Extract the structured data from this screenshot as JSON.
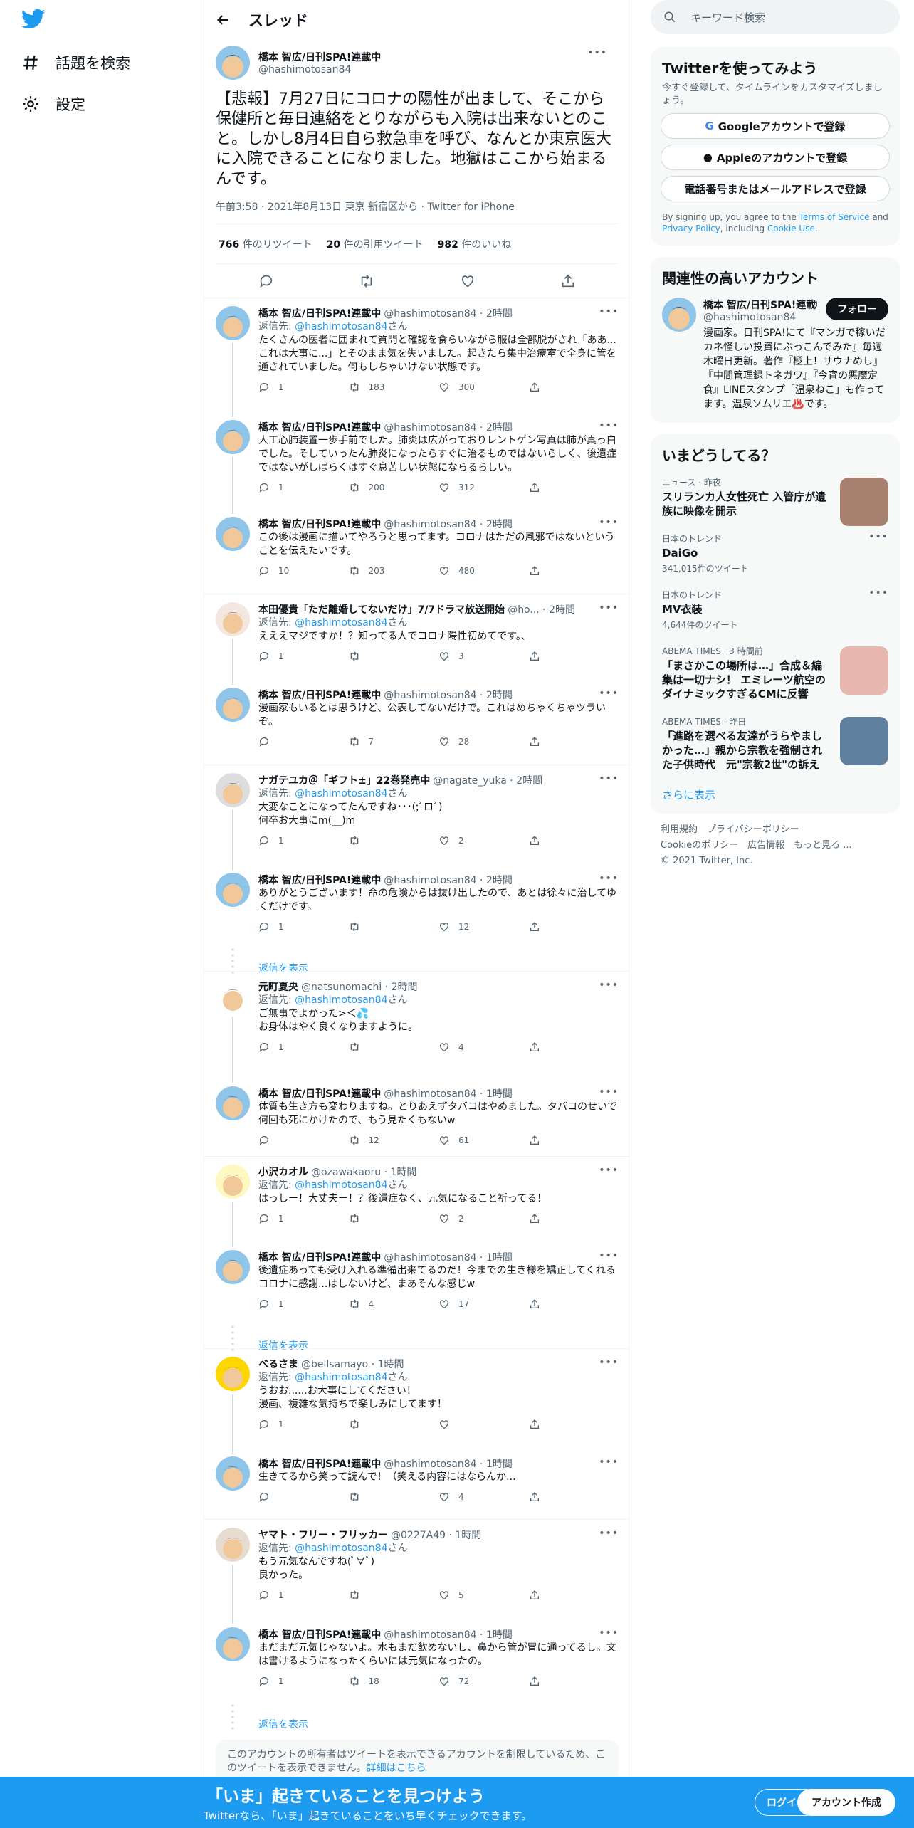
{
  "nav": {
    "explore": "話題を検索",
    "settings": "設定"
  },
  "header": {
    "title": "スレッド"
  },
  "focal": {
    "name": "橋本 智広/日刊SPA!連載中",
    "handle": "@hashimotosan84",
    "text": "【悲報】7月27日にコロナの陽性が出まして、そこから保健所と毎日連絡をとりながらも入院は出来ないとのこと。しかし8月4日自ら救急車を呼び、なんとか東京医大に入院できることになりました。地獄はここから始まるんです。",
    "meta": "午前3:58 · 2021年8月13日 東京 新宿区から · Twitter for iPhone",
    "rt_count": "766",
    "rt_label": "件のリツイート",
    "quote_count": "20",
    "quote_label": "件の引用ツイート",
    "like_count": "982",
    "like_label": "件のいいね"
  },
  "replies": [
    {
      "name": "橋本 智広/日刊SPA!連載中",
      "handle": "@hashimotosan84 · 2時間",
      "reply_to": "@hashimotosan84",
      "text": "たくさんの医者に囲まれて質問と確認を食らいながら服は全部脱がされ「ああ...これは大事に...」とそのまま気を失いました。起きたら集中治療室で全身に管を通されていました。何もしちゃいけない状態です。",
      "c": "1",
      "r": "183",
      "l": "300"
    },
    {
      "name": "橋本 智広/日刊SPA!連載中",
      "handle": "@hashimotosan84 · 2時間",
      "reply_to": "",
      "text": "人工心肺装置一歩手前でした。肺炎は広がっておりレントゲン写真は肺が真っ白でした。そしていったん肺炎になったらすぐに治るものではないらしく、後遺症ではないがしばらくはすぐ息苦しい状態にならるらしい。",
      "c": "1",
      "r": "200",
      "l": "312"
    },
    {
      "name": "橋本 智広/日刊SPA!連載中",
      "handle": "@hashimotosan84 · 2時間",
      "reply_to": "",
      "text": "この後は漫画に描いてやろうと思ってます。コロナはただの風邪ではないということを伝えたいです。",
      "c": "10",
      "r": "203",
      "l": "480"
    },
    {
      "name": "本田優貴「ただ離婚してないだけ」7/7ドラマ放送開始",
      "handle": "@ho... · 2時間",
      "reply_to": "@hashimotosan84",
      "text": "えええマジですか！？知ってる人でコロナ陽性初めてです。、",
      "c": "1",
      "r": "",
      "l": "3"
    },
    {
      "name": "橋本 智広/日刊SPA!連載中",
      "handle": "@hashimotosan84 · 2時間",
      "reply_to": "",
      "text": "漫画家もいるとは思うけど、公表してないだけで。これはめちゃくちゃツラいぞ。",
      "c": "",
      "r": "7",
      "l": "28"
    },
    {
      "name": "ナガテユカ＠「ギフト±」22巻発売中",
      "handle": "@nagate_yuka · 2時間",
      "reply_to": "@hashimotosan84",
      "text": "大変なことになってたんですね･･･(;ﾟロﾟ)\n何卒お大事にm(__)m",
      "c": "1",
      "r": "",
      "l": "2"
    },
    {
      "name": "橋本 智広/日刊SPA!連載中",
      "handle": "@hashimotosan84 · 2時間",
      "reply_to": "",
      "text": "ありがとうございます！命の危険からは抜け出したので、あとは徐々に治してゆくだけです。",
      "c": "1",
      "r": "",
      "l": "12"
    },
    {
      "name": "元町夏央",
      "handle": "@natsunomachi · 2時間",
      "reply_to": "@hashimotosan84",
      "text": "ご無事でよかった>＜💦\nお身体はやく良くなりますように。",
      "c": "1",
      "r": "",
      "l": "4"
    },
    {
      "name": "橋本 智広/日刊SPA!連載中",
      "handle": "@hashimotosan84 · 1時間",
      "reply_to": "",
      "text": "体質も生き方も変わりますね。とりあえずタバコはやめました。タバコのせいで何回も死にかけたので、もう見たくもないw",
      "c": "",
      "r": "12",
      "l": "61"
    },
    {
      "name": "小沢カオル",
      "handle": "@ozawakaoru · 1時間",
      "reply_to": "@hashimotosan84",
      "text": "はっしー！大丈夫ー！？後遺症なく、元気になること祈ってる！",
      "c": "1",
      "r": "",
      "l": "2"
    },
    {
      "name": "橋本 智広/日刊SPA!連載中",
      "handle": "@hashimotosan84 · 1時間",
      "reply_to": "",
      "text": "後遺症あっても受け入れる準備出来てるのだ！今までの生き様を矯正してくれるコロナに感謝...はしないけど、まあそんな感じw",
      "c": "1",
      "r": "4",
      "l": "17"
    },
    {
      "name": "べるさま",
      "handle": "@bellsamayo · 1時間",
      "reply_to": "@hashimotosan84",
      "text": "うおお......お大事にしてください！\n漫画、複雑な気持ちで楽しみにしてます！",
      "c": "1",
      "r": "",
      "l": ""
    },
    {
      "name": "橋本 智広/日刊SPA!連載中",
      "handle": "@hashimotosan84 · 1時間",
      "reply_to": "",
      "text": "生きてるから笑って読んで！（笑える内容にはならんか...",
      "c": "",
      "r": "",
      "l": "4"
    },
    {
      "name": "ヤマト・フリー・フリッカー",
      "handle": "@0227A49 · 1時間",
      "reply_to": "@hashimotosan84",
      "text": "もう元気なんですね(ﾟ∀ﾟ)\n良かった。",
      "c": "1",
      "r": "",
      "l": "5"
    },
    {
      "name": "橋本 智広/日刊SPA!連載中",
      "handle": "@hashimotosan84 · 1時間",
      "reply_to": "",
      "text": "まだまだ元気じゃないよ。水もまだ飲めないし、鼻から管が胃に通ってるし。文は書けるようになったくらいには元気になったの。",
      "c": "1",
      "r": "18",
      "l": "72"
    }
  ],
  "reply_prefix": "返信先: ",
  "reply_suffix": "さん",
  "show_replies": "返信を表示",
  "notice": {
    "text": "このアカウントの所有者はツイートを表示できるアカウントを制限しているため、このツイートを表示できません。",
    "link": "詳細はこちら"
  },
  "search": {
    "placeholder": "キーワード検索"
  },
  "signup": {
    "title": "Twitterを使ってみよう",
    "sub": "今すぐ登録して、タイムラインをカスタマイズしましょう。",
    "google": "Googleアカウントで登録",
    "apple": "Appleのアカウントで登録",
    "phone": "電話番号またはメールアドレスで登録",
    "legal1": "By signing up, you agree to the ",
    "tos": "Terms of Service",
    "and": " and ",
    "privacy": "Privacy Policy",
    "incl": ", including ",
    "cookie": "Cookie Use",
    "dot": "."
  },
  "related": {
    "title": "関連性の高いアカウント",
    "name": "橋本 智広/日刊SPA!連載中",
    "handle": "@hashimotosan84",
    "follow": "フォロー",
    "bio": "漫画家。日刊SPA!にて『マンガで稼いだカネ怪しい投資にぶっこんでみた』毎週木曜日更新。著作『極上！サウナめし』『中間管理録トネガワ』『今宵の悪魔定食』LINEスタンプ「温泉ねこ」も作ってます。温泉ソムリエ♨️です。"
  },
  "trends": {
    "title": "いまどうしてる？",
    "items": [
      {
        "cat": "ニュース · 昨夜",
        "title": "スリランカ人女性死亡 入管庁が遺族に映像を開示",
        "count": ""
      },
      {
        "cat": "日本のトレンド",
        "title": "DaiGo",
        "count": "341,015件のツイート"
      },
      {
        "cat": "日本のトレンド",
        "title": "MV衣装",
        "count": "4,644件のツイート"
      },
      {
        "cat": "ABEMA TIMES · 3 時間前",
        "title": "「まさかこの場所は…」合成＆編集は一切ナシ！ エミレーツ航空のダイナミックすぎるCMに反響",
        "count": ""
      },
      {
        "cat": "ABEMA TIMES · 昨日",
        "title": "「進路を選べる友達がうらやましかった…」親から宗教を強制された子供時代　元\"宗教2世\"の訴え",
        "count": ""
      }
    ],
    "more": "さらに表示"
  },
  "footer": {
    "line1": "利用規約　プライバシーポリシー",
    "line2": "Cookieのポリシー　広告情報　もっと見る ...",
    "line3": "© 2021 Twitter, Inc."
  },
  "bottom": {
    "headline": "「いま」起きていることを見つけよう",
    "sub": "Twitterなら、「いま」起きていることをいち早くチェックできます。",
    "login": "ログイン",
    "signup": "アカウント作成"
  },
  "colors": {
    "accent": "#1d9bf0",
    "text": "#0f1419",
    "muted": "#536471"
  }
}
